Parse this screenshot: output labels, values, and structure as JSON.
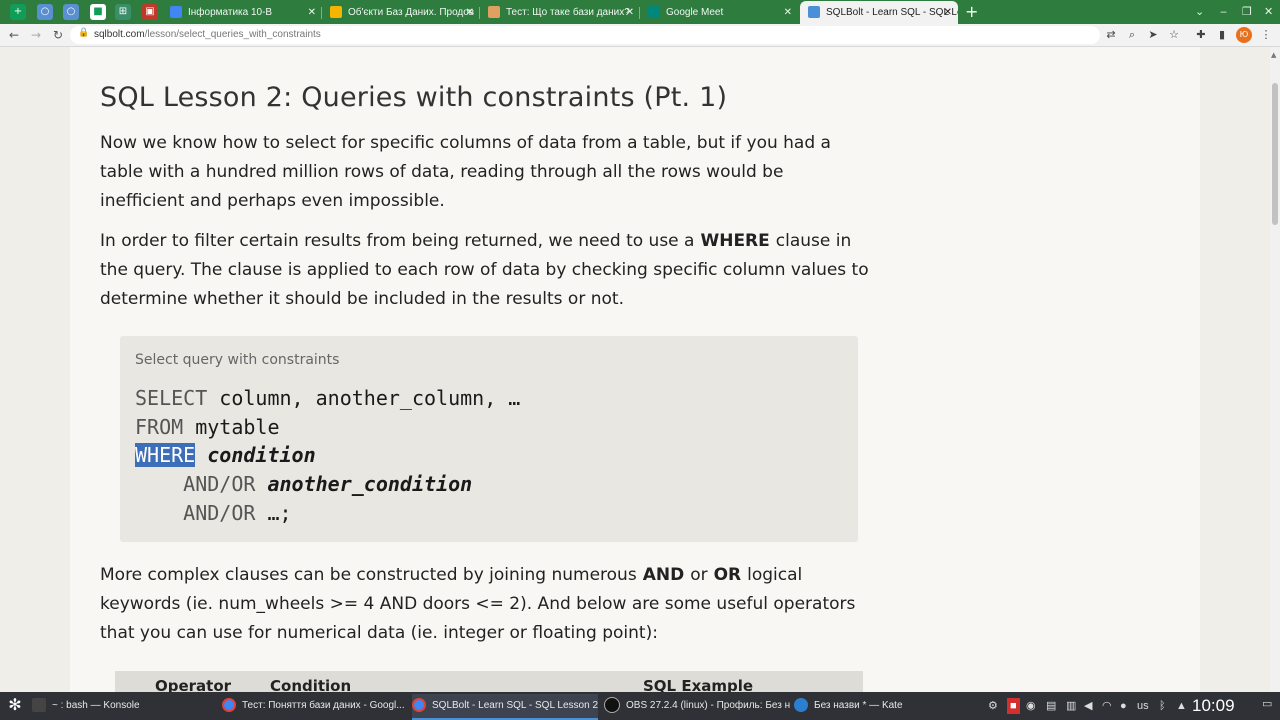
{
  "browser": {
    "tabs": [
      {
        "label": "Інформатика 10-В",
        "fav": "#4285f4"
      },
      {
        "label": "Об'єкти Баз Даних. Продов",
        "fav": "#f4b400"
      },
      {
        "label": "Тест: Що таке бази даних?",
        "fav": "#e0a060"
      },
      {
        "label": "Google Meet",
        "fav": "#00897b"
      },
      {
        "label": "SQLBolt - Learn SQL - SQL Le",
        "fav": "#4a90d9"
      }
    ],
    "url_host": "sqlbolt.com",
    "url_path": "/lesson/select_queries_with_constraints",
    "profile_initial": "Ю"
  },
  "lesson": {
    "title": "SQL Lesson 2: Queries with constraints (Pt. 1)",
    "p1": "Now we know how to select for specific columns of data from a table, but if you had a table with a hundred million rows of data, reading through all the rows would be inefficient and perhaps even impossible.",
    "p2_before": "In order to filter certain results from being returned, we need to use a",
    "p2_kw": "WHERE",
    "p2_after": "clause in the query. The clause is applied to each row of data by checking specific column values to determine whether it should be included in the results or not.",
    "code_caption": "Select query with constraints",
    "code": {
      "l1_kw": "SELECT",
      "l1_rest": " column, another_column, …",
      "l2_kw": "FROM",
      "l2_rest": " mytable",
      "l3_kw": "WHERE",
      "l3_rest": "condition",
      "l4_kw": "AND/OR",
      "l4_rest": "another_condition",
      "l5_kw": "AND/OR",
      "l5_rest": " …;"
    },
    "p3_a": "More complex clauses can be constructed by joining numerous",
    "p3_kw1": "AND",
    "p3_or": "or",
    "p3_kw2": "OR",
    "p3_b": "logical keywords (ie. num_wheels >= 4 AND doors <= 2). And below are some useful operators that you can use for numerical data (ie. integer or floating point):",
    "table_headers": [
      "Operator",
      "Condition",
      "SQL Example"
    ]
  },
  "taskbar": {
    "tasks": [
      {
        "label": "~ : bash — Konsole",
        "color": "#444"
      },
      {
        "label": "Тест: Поняття бази даних - Googl...",
        "color": "#4285f4"
      },
      {
        "label": "SQLBolt - Learn SQL - SQL Lesson 2...",
        "color": "#4285f4"
      },
      {
        "label": "OBS 27.2.4 (linux) - Профиль: Без н...",
        "color": "#222"
      },
      {
        "label": "Без назви * — Kate",
        "color": "#2b7fd0"
      }
    ],
    "keyboard_layout": "us",
    "clock": "10:09"
  }
}
